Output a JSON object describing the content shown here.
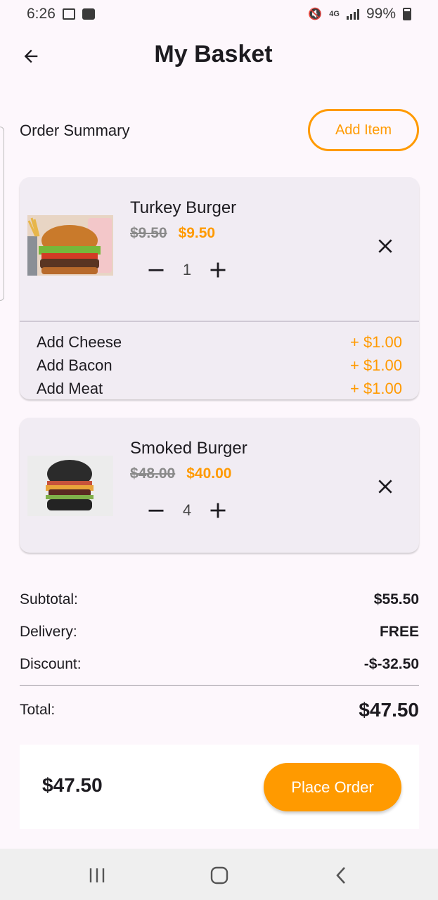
{
  "status_bar": {
    "time": "6:26",
    "battery": "99%"
  },
  "header": {
    "title": "My Basket"
  },
  "summary": {
    "label": "Order Summary",
    "add_item_label": "Add Item"
  },
  "items": [
    {
      "name": "Turkey Burger",
      "old_price": "$9.50",
      "price": "$9.50",
      "quantity": "1",
      "addons": [
        {
          "label": "Add Cheese",
          "price": "+ $1.00"
        },
        {
          "label": "Add Bacon",
          "price": "+ $1.00"
        },
        {
          "label": "Add Meat",
          "price": "+ $1.00"
        }
      ]
    },
    {
      "name": "Smoked Burger",
      "old_price": "$48.00",
      "price": "$40.00",
      "quantity": "4",
      "addons": []
    }
  ],
  "totals": {
    "subtotal_label": "Subtotal:",
    "subtotal": "$55.50",
    "delivery_label": "Delivery:",
    "delivery": "FREE",
    "discount_label": "Discount:",
    "discount": "-$-32.50",
    "total_label": "Total:",
    "total": "$47.50"
  },
  "checkout": {
    "price": "$47.50",
    "button_label": "Place Order"
  },
  "colors": {
    "accent": "#ff9a00",
    "card": "#f1ecf3",
    "background": "#fdf7fc"
  }
}
